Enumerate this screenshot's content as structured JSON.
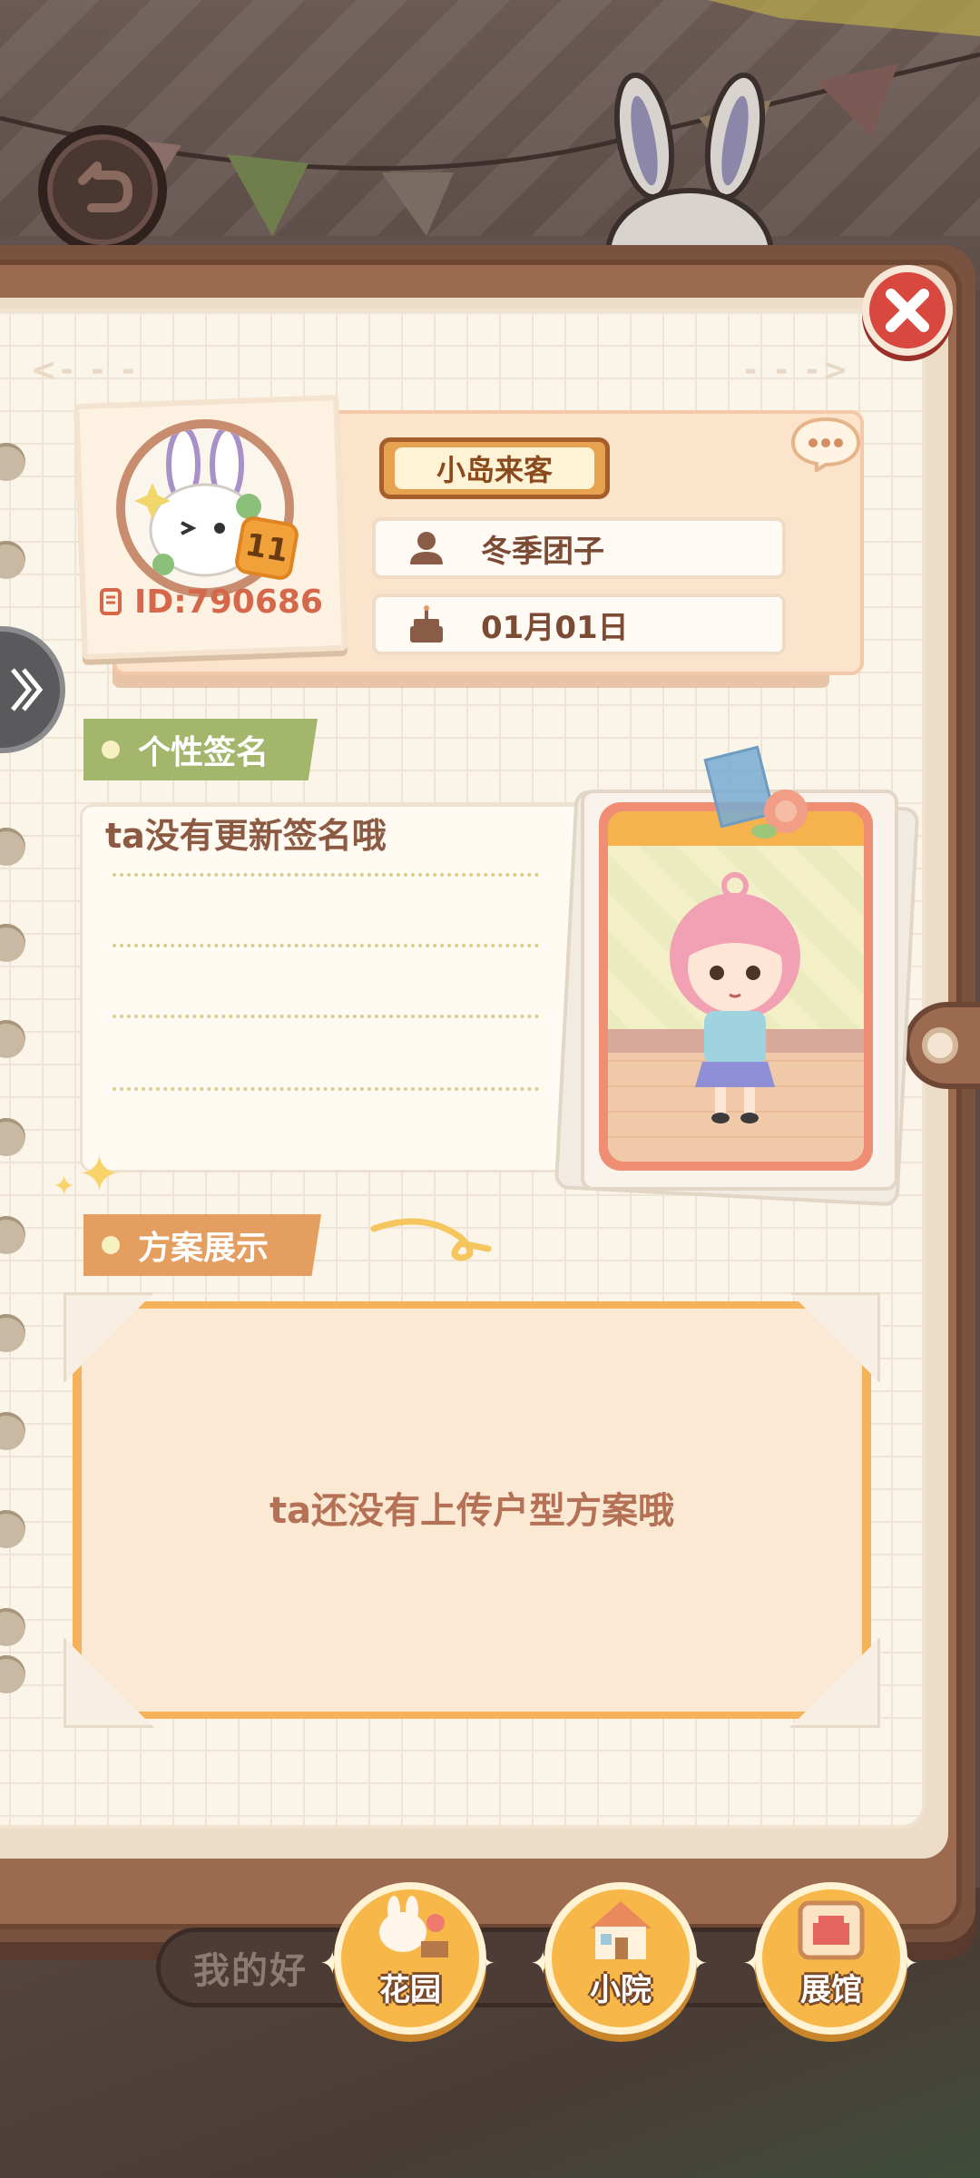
{
  "profile": {
    "title_badge": "小岛来客",
    "nickname": "冬季团子",
    "birthday": "01月01日",
    "level": "11",
    "id_text": "ID:790686"
  },
  "signature": {
    "section_label": "个性签名",
    "text": "ta没有更新签名哦"
  },
  "plan": {
    "section_label": "方案展示",
    "empty_text": "ta还没有上传户型方案哦"
  },
  "bottom_bar": {
    "friend_text": "我的好"
  },
  "nav": [
    {
      "label": "花园",
      "icon": "garden-icon"
    },
    {
      "label": "小院",
      "icon": "house-icon"
    },
    {
      "label": "展馆",
      "icon": "gallery-icon"
    }
  ],
  "colors": {
    "close": "#d9483f",
    "signature_label": "#a4b56c",
    "plan_label": "#e49e60",
    "id_text": "#d5684a",
    "nav_button": "#f7b849"
  }
}
